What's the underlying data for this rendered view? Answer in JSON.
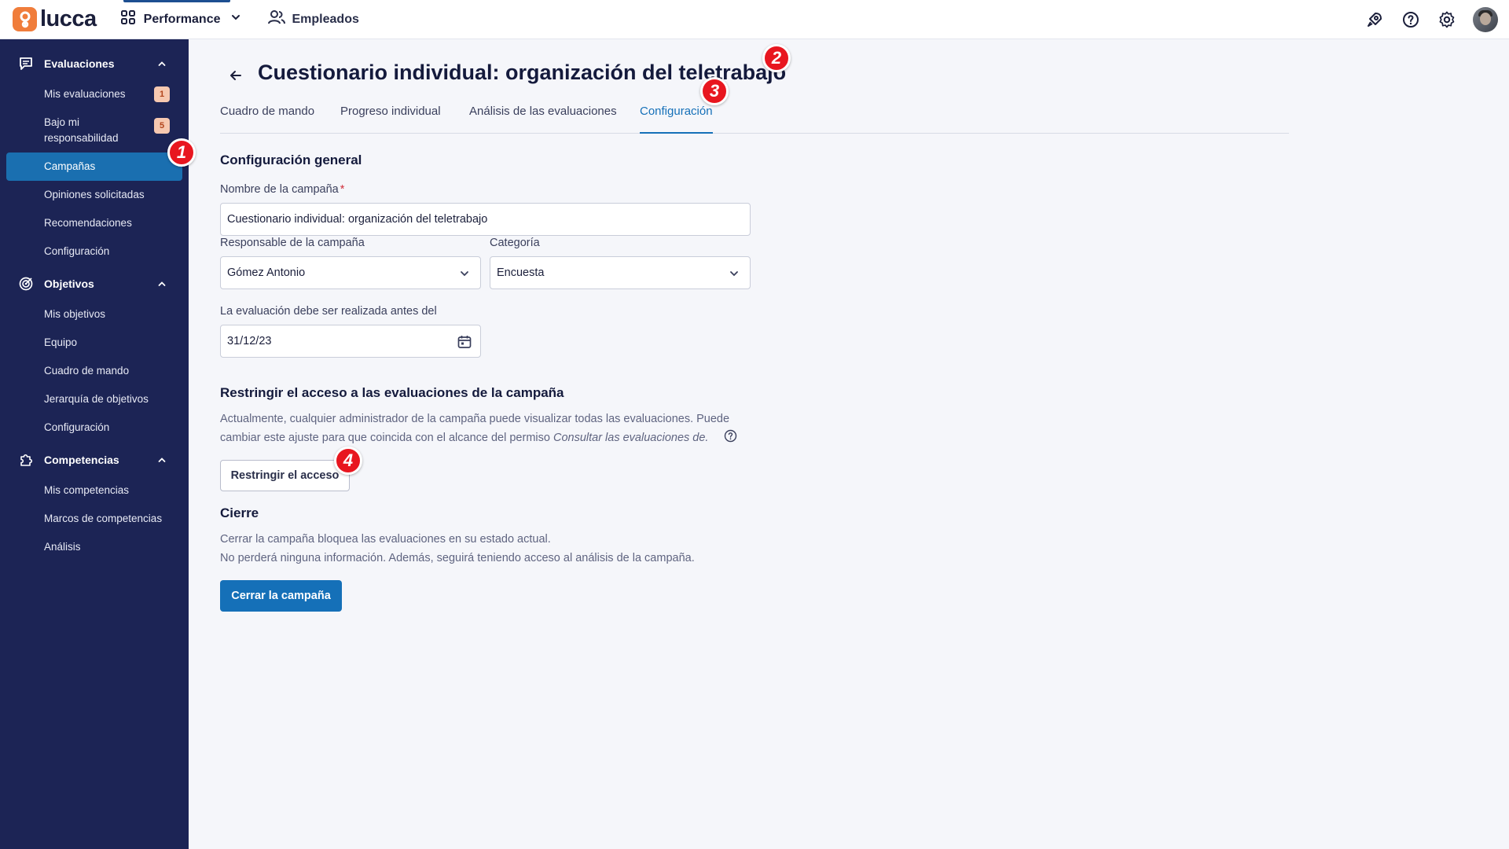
{
  "topbar": {
    "logo_text": "lucca",
    "app_label": "Performance",
    "people_label": "Empleados",
    "icons": [
      "rocket-icon",
      "help-icon",
      "settings-icon"
    ]
  },
  "sidebar": {
    "sections": [
      {
        "title": "Evaluaciones",
        "icon": "feedback-icon",
        "items": [
          {
            "label": "Mis evaluaciones",
            "count": "1"
          },
          {
            "label": "Bajo mi responsabilidad",
            "count": "5"
          },
          {
            "label": "Campañas",
            "active": true
          },
          {
            "label": "Opiniones solicitadas"
          },
          {
            "label": "Recomendaciones"
          },
          {
            "label": "Configuración"
          }
        ]
      },
      {
        "title": "Objetivos",
        "icon": "target-icon",
        "items": [
          {
            "label": "Mis objetivos"
          },
          {
            "label": "Equipo"
          },
          {
            "label": "Cuadro de mando"
          },
          {
            "label": "Jerarquía de objetivos"
          },
          {
            "label": "Configuración"
          }
        ]
      },
      {
        "title": "Competencias",
        "icon": "puzzle-icon",
        "items": [
          {
            "label": "Mis competencias"
          },
          {
            "label": "Marcos de competencias"
          },
          {
            "label": "Análisis"
          }
        ]
      }
    ]
  },
  "main": {
    "title": "Cuestionario individual: organización del teletrabajo",
    "tabs": [
      {
        "label": "Cuadro de mando"
      },
      {
        "label": "Progreso individual"
      },
      {
        "label": "Análisis de las evaluaciones"
      },
      {
        "label": "Configuración",
        "active": true
      }
    ],
    "general": {
      "heading": "Configuración general",
      "name_label": "Nombre de la campaña",
      "required_mark": "*",
      "name_value": "Cuestionario individual: organización del teletrabajo",
      "owner_label": "Responsable de la campaña",
      "owner_value": "Gómez Antonio",
      "category_label": "Categoría",
      "category_value": "Encuesta",
      "due_label": "La evaluación debe ser realizada antes del",
      "due_value": "31/12/23"
    },
    "restrict": {
      "heading": "Restringir el acceso a las evaluaciones de la campaña",
      "desc_line1": "Actualmente, cualquier administrador de la campaña puede visualizar todas las evaluaciones. Puede",
      "desc_line2": "cambiar este ajuste para que coincida con el alcance del permiso ",
      "desc_italic": "Consultar las evaluaciones de.",
      "button": "Restringir el acceso"
    },
    "closing": {
      "heading": "Cierre",
      "line1": "Cerrar la campaña bloquea las evaluaciones en su estado actual.",
      "line2": "No perderá ninguna información. Además, seguirá teniendo acceso al análisis de la campaña.",
      "button": "Cerrar la campaña"
    }
  },
  "markers": [
    "1",
    "2",
    "3",
    "4"
  ],
  "colors": {
    "sidebar_bg": "#1c2455",
    "accent": "#1570b8",
    "brand": "#f07d3b",
    "marker": "#e8161f"
  }
}
